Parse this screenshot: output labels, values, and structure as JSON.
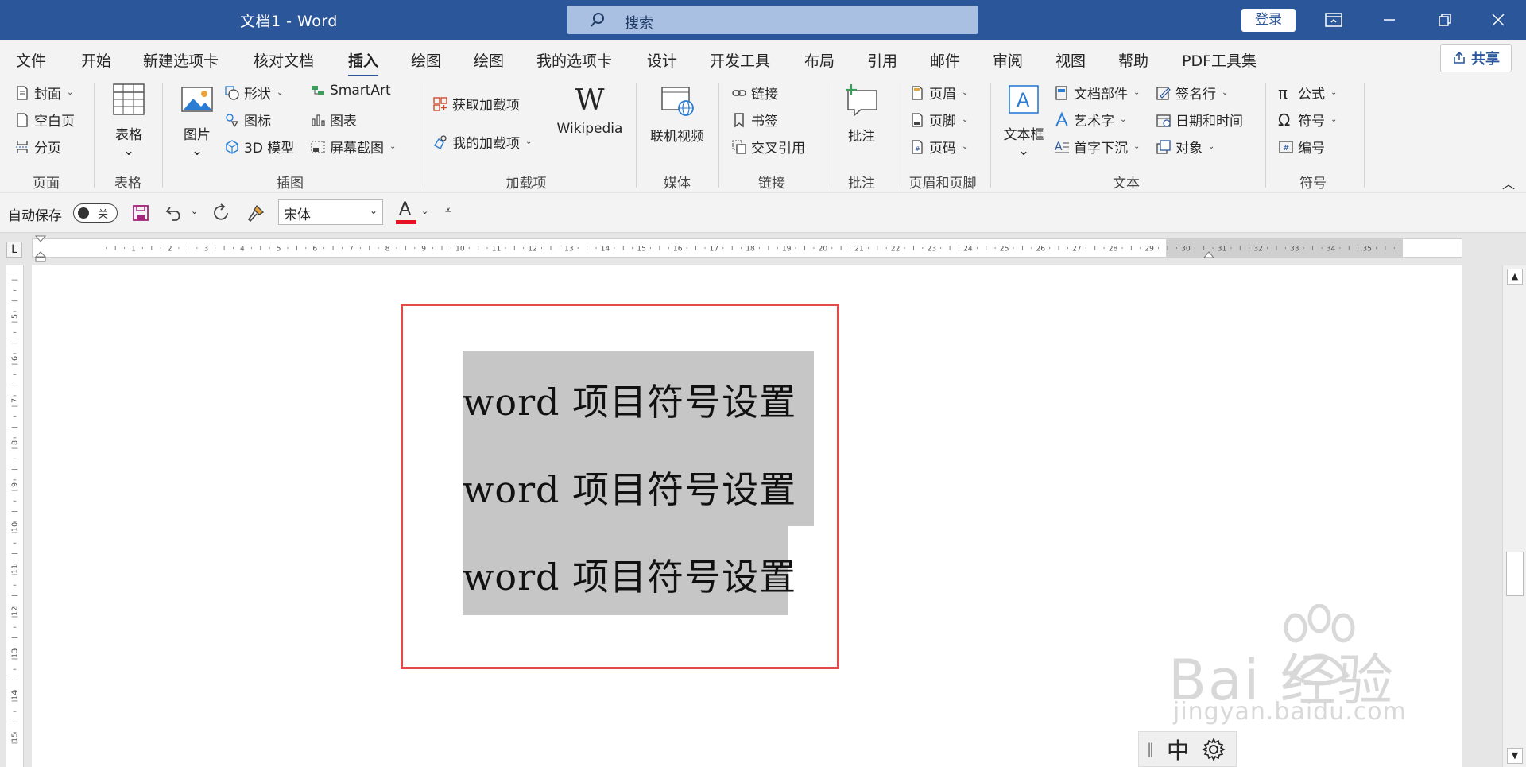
{
  "titlebar": {
    "doc_title": "文档1  -  Word",
    "search_placeholder": "搜索",
    "login_label": "登录"
  },
  "menu": {
    "tabs": [
      "文件",
      "开始",
      "新建选项卡",
      "核对文档",
      "插入",
      "绘图",
      "绘图",
      "我的选项卡",
      "设计",
      "开发工具",
      "布局",
      "引用",
      "邮件",
      "审阅",
      "视图",
      "帮助",
      "PDF工具集"
    ],
    "active_tab": "插入",
    "share_label": "共享"
  },
  "ribbon": {
    "page": {
      "label": "页面",
      "cover": "封面",
      "blank": "空白页",
      "break": "分页"
    },
    "table": {
      "label": "表格",
      "table": "表格"
    },
    "illustrations": {
      "label": "插图",
      "picture": "图片",
      "shapes": "形状",
      "icons": "图标",
      "model3d": "3D 模型",
      "smartart": "SmartArt",
      "chart": "图表",
      "screenshot": "屏幕截图"
    },
    "addins": {
      "label": "加载项",
      "get": "获取加载项",
      "mine": "我的加载项",
      "wikipedia": "Wikipedia"
    },
    "media": {
      "label": "媒体",
      "video": "联机视频"
    },
    "links": {
      "label": "链接",
      "link": "链接",
      "bookmark": "书签",
      "crossref": "交叉引用"
    },
    "comments": {
      "label": "批注",
      "comment": "批注"
    },
    "header_footer": {
      "label": "页眉和页脚",
      "header": "页眉",
      "footer": "页脚",
      "page_number": "页码"
    },
    "text": {
      "label": "文本",
      "textbox": "文本框",
      "quickparts": "文档部件",
      "wordart": "艺术字",
      "dropcap": "首字下沉",
      "signature": "签名行",
      "datetime": "日期和时间",
      "object": "对象"
    },
    "symbols": {
      "label": "符号",
      "equation": "公式",
      "symbol": "符号",
      "number": "编号"
    }
  },
  "qat": {
    "autosave_label": "自动保存",
    "autosave_state": "关",
    "font_name": "宋体"
  },
  "ruler_numbers": [
    "1",
    "2",
    "3",
    "4",
    "5",
    "6",
    "7",
    "8",
    "9",
    "10",
    "11",
    "12",
    "13",
    "14",
    "15",
    "16",
    "17",
    "18",
    "19",
    "20",
    "21",
    "22",
    "23",
    "24",
    "25",
    "26",
    "27",
    "28",
    "29",
    "30",
    "31",
    "32",
    "33",
    "34",
    "35",
    "36"
  ],
  "vruler_numbers": [
    "5",
    "6",
    "7",
    "8",
    "9",
    "10",
    "11",
    "12",
    "13",
    "14",
    "15"
  ],
  "document": {
    "lines": [
      "word 项目符号设置",
      "word 项目符号设置",
      "word 项目符号设置"
    ]
  },
  "ime": {
    "mode": "中"
  },
  "watermark": {
    "brand": "Bai 经验",
    "site": "jingyan.baidu.com"
  },
  "colors": {
    "title_bar": "#2b579a",
    "ribbon_bg": "#f3f3f3",
    "highlight_box": "#e34a4a",
    "selection": "#c6c6c6"
  }
}
